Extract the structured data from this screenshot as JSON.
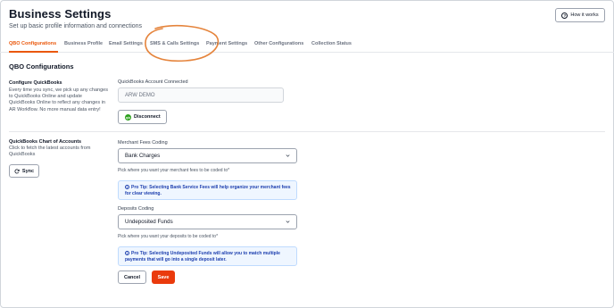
{
  "header": {
    "title": "Business Settings",
    "subtitle": "Set up basic profile information and connections",
    "how_it_works_label": "How it works",
    "how_icon": "question-circle-icon"
  },
  "tabs": [
    {
      "label": "QBO Configurations",
      "active": true
    },
    {
      "label": "Business Profile",
      "active": false
    },
    {
      "label": "Email Settings",
      "active": false
    },
    {
      "label": "SMS & Calls Settings",
      "active": false
    },
    {
      "label": "Payment Settings",
      "active": false
    },
    {
      "label": "Other Configurations",
      "active": false
    },
    {
      "label": "Collection Status",
      "active": false
    }
  ],
  "colors": {
    "accent": "#ea580c",
    "save": "#ea3a0c",
    "annotation": "#e5843c",
    "tip_bg": "#eff6ff",
    "tip_text": "#1e40af"
  },
  "section": {
    "title": "QBO Configurations"
  },
  "configure": {
    "heading": "Configure QuickBooks",
    "description": "Every time you sync, we pick up any changes to QuickBooks Online and update QuickBooks Online to reflect any changes in AR Workflow. No more manual data entry!",
    "account_label": "QuickBooks Account Connected",
    "account_value": "ARW DEMO",
    "disconnect_label": "Disconnect",
    "qb_icon": "quickbooks-logo-icon"
  },
  "chart_of_accounts": {
    "heading": "QuickBooks Chart of Accounts",
    "description": "Click to fetch the latest accounts from QuickBooks",
    "sync_label": "Sync",
    "sync_icon": "refresh-icon"
  },
  "merchant_fees": {
    "label": "Merchant Fees Coding",
    "selected": "Bank Charges",
    "hint": "Pick where you want your merchant fees to be coded to*",
    "tip": "Pro Tip: Selecting Bank Service Fees will help organize your merchant fees for clear viewing."
  },
  "deposits": {
    "label": "Deposits Coding",
    "selected": "Undeposited Funds",
    "hint": "Pick where you want your deposits to be coded to*",
    "tip": "Pro Tip: Selecting Undeposited Funds will allow you to match multiple payments that will go into a single deposit later."
  },
  "actions": {
    "cancel_label": "Cancel",
    "save_label": "Save"
  }
}
